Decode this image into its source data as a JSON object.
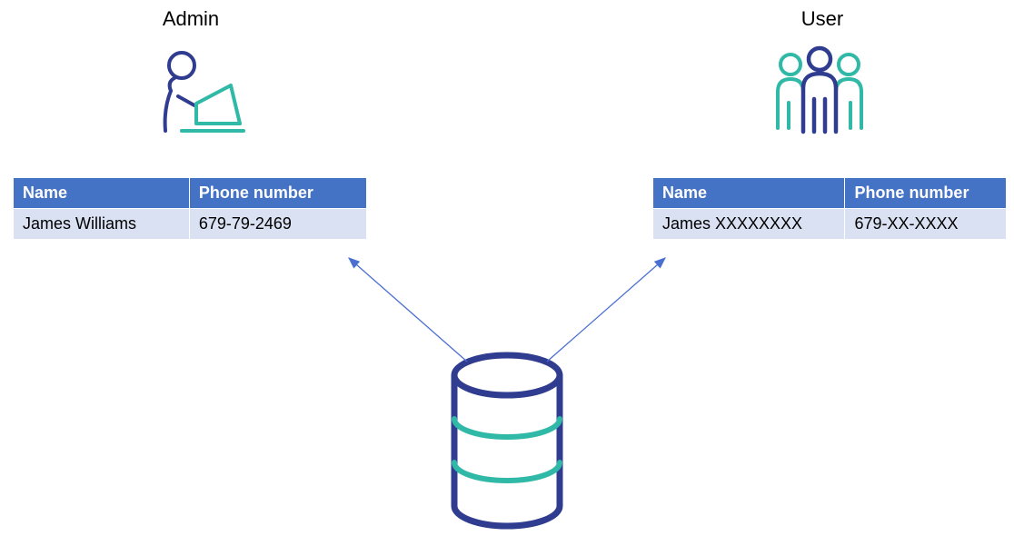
{
  "colors": {
    "tableHeaderBg": "#4472C4",
    "tableRowBg": "#D9E1F2",
    "navy": "#2F3C8F",
    "teal": "#2FB9A6",
    "arrow": "#4A6FD1"
  },
  "admin": {
    "title": "Admin",
    "table": {
      "headers": {
        "name": "Name",
        "phone": "Phone number"
      },
      "row": {
        "name": "James Williams",
        "phone": "679-79-2469"
      }
    }
  },
  "user": {
    "title": "User",
    "table": {
      "headers": {
        "name": "Name",
        "phone": "Phone number"
      },
      "row": {
        "name": "James XXXXXXXX",
        "phone": "679-XX-XXXX"
      }
    }
  },
  "icons": {
    "admin": "admin-at-laptop-icon",
    "user": "user-group-icon",
    "database": "database-icon"
  }
}
